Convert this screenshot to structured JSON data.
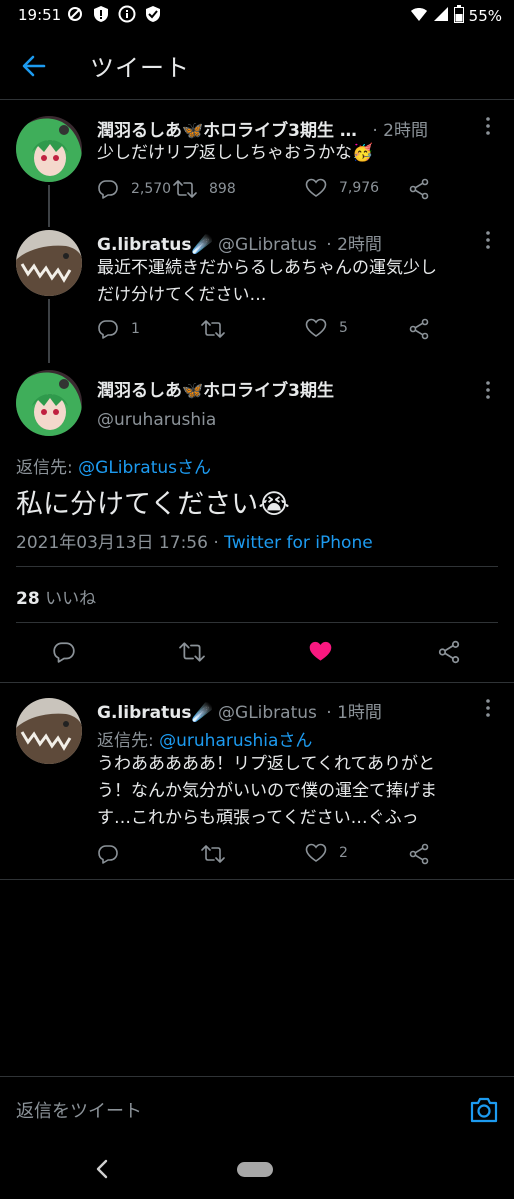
{
  "status_bar": {
    "time": "19:51",
    "battery": "55%"
  },
  "header": {
    "title": "ツイート"
  },
  "tweets": [
    {
      "display_name": "潤羽るしあ🦋ホロライブ3期生 …",
      "time": "· 2時間",
      "text": "少しだけリプ返ししちゃおうかな🥳",
      "replies": "2,570",
      "retweets": "898",
      "likes": "7,976"
    },
    {
      "display_name": "G.libratus☄️",
      "handle": "@GLibratus",
      "time": "· 2時間",
      "text_lines": [
        "最近不運続きだからるしあちゃんの運気少し",
        "だけ分けてください…"
      ],
      "replies": "1",
      "likes": "5"
    }
  ],
  "main_tweet": {
    "display_name": "潤羽るしあ🦋ホロライブ3期生",
    "handle": "@uruharushia",
    "reply_to_prefix": "返信先: ",
    "reply_to": "@GLibratusさん",
    "text": "私に分けてください😭",
    "timestamp": "2021年03月13日 17:56 · ",
    "source": "Twitter for iPhone",
    "likes_count": "28",
    "likes_label": " いいね"
  },
  "reply_tweet": {
    "display_name": "G.libratus☄️",
    "handle": "@GLibratus",
    "time": "· 1時間",
    "reply_to_prefix": "返信先: ",
    "reply_to": "@uruharushiaさん",
    "text_lines": [
      "うわあああああ！リプ返してくれてありがと",
      "う！なんか気分がいいので僕の運全て捧げま",
      "す…これからも頑張ってください…ぐふっ"
    ],
    "likes": "2"
  },
  "reply_bar": {
    "placeholder": "返信をツイート"
  },
  "colors": {
    "accent": "#1d9bf0",
    "like": "#f91880",
    "background": "#000000"
  }
}
